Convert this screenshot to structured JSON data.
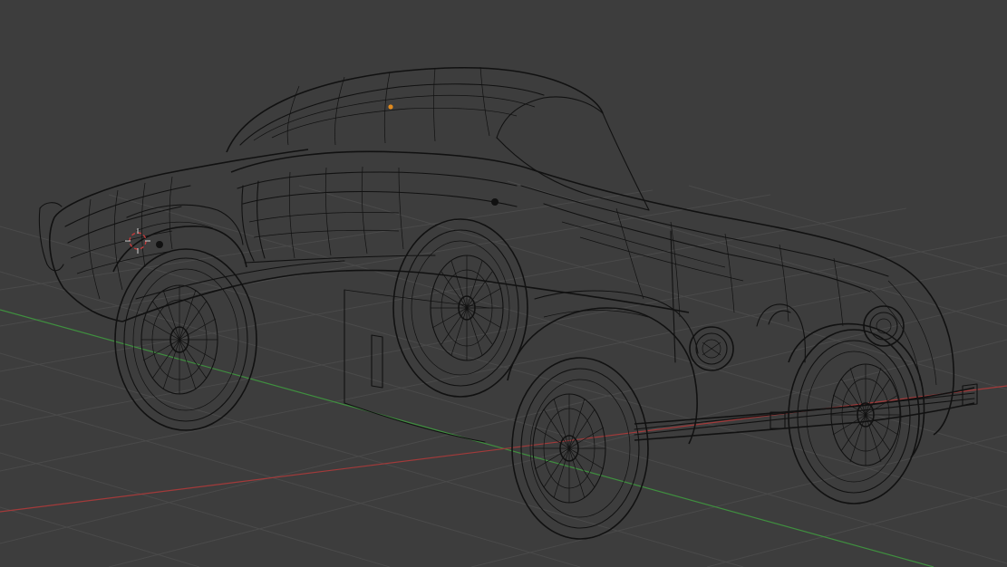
{
  "viewport": {
    "background_color": "#3d3d3d",
    "grid_color": "#4a4a4a",
    "x_axis_color": "#a33a3a",
    "y_axis_color": "#3f8f3f",
    "wire_color": "#111111",
    "origin_color": "#e08a1e",
    "cursor_color": "#d0d0d0",
    "cursor_accent_color": "#c23a3a"
  },
  "scene": {
    "object": "car-wireframe",
    "shading": "wireframe"
  }
}
